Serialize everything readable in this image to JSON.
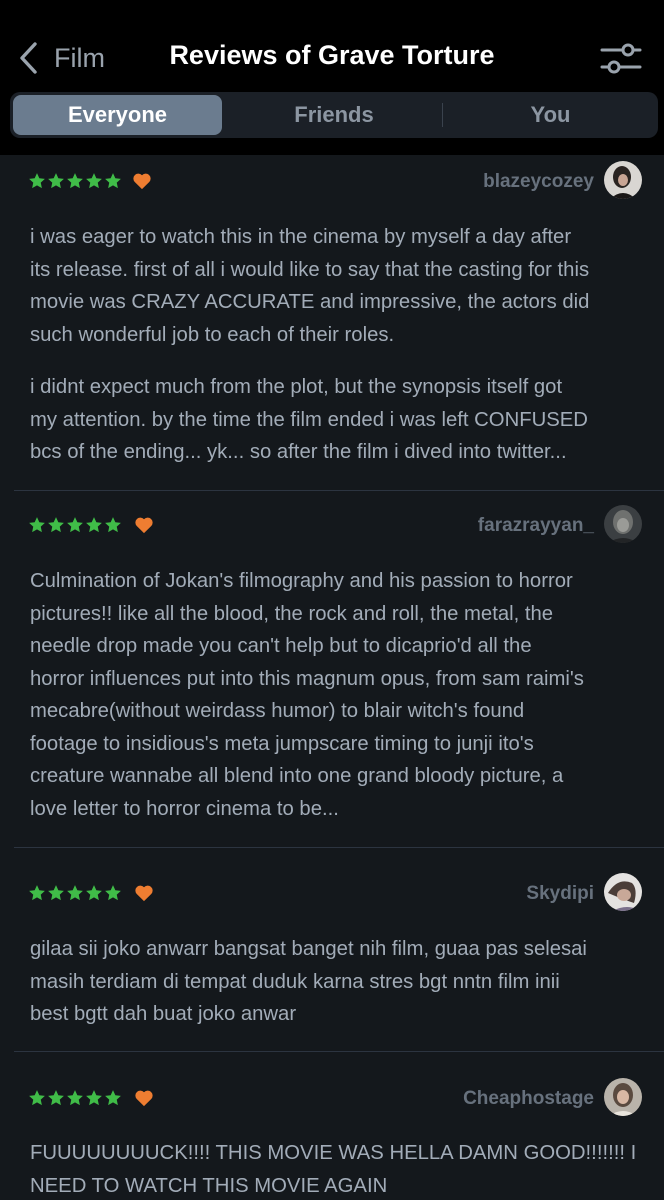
{
  "header": {
    "back_label": "Film",
    "title": "Reviews of Grave Torture"
  },
  "tabs": [
    {
      "label": "Everyone",
      "active": true
    },
    {
      "label": "Friends",
      "active": false
    },
    {
      "label": "You",
      "active": false
    }
  ],
  "colors": {
    "background": "#14181c",
    "star": "#40bc48",
    "heart": "#ee7d31",
    "active_tab": "#6b7c8f"
  },
  "reviews": [
    {
      "username": "blazeycozey",
      "rating": 5,
      "liked": true,
      "lines": [
        [
          "i was eager to watch this in the cinema by myself a day after",
          "its release. first of all i would like to say that the casting for this",
          "movie was CRAZY ACCURATE and impressive, the actors did",
          "such wonderful job to each of their roles."
        ],
        [
          "i didnt expect much from the plot, but the synopsis itself got",
          "my attention. by the time the film ended i was left CONFUSED",
          "bcs of the ending... yk... so after the film i dived into twitter..."
        ]
      ]
    },
    {
      "username": "farazrayyan_",
      "rating": 5,
      "liked": true,
      "lines": [
        [
          "Culmination of Jokan's filmography and his passion to horror",
          "pictures!! like all the blood, the rock and roll, the metal, the",
          "needle drop made you can't help but to dicaprio'd all the",
          "horror influences put into this magnum opus, from sam raimi's",
          "mecabre(without weirdass humor) to blair witch's found",
          "footage to insidious's meta jumpscare timing to junji ito's",
          "creature wannabe all blend into one grand bloody picture, a",
          "love letter to horror cinema to be..."
        ]
      ]
    },
    {
      "username": "Skydipi",
      "rating": 5,
      "liked": true,
      "lines": [
        [
          "gilaa sii joko anwarr bangsat banget nih film, guaa pas selesai",
          "masih terdiam di tempat duduk karna stres bgt nntn film inii",
          "best bgtt dah buat joko anwar"
        ]
      ]
    },
    {
      "username": "Cheaphostage",
      "rating": 5,
      "liked": true,
      "lines": [
        [
          "FUUUUUUUUCK!!!! THIS MOVIE WAS HELLA DAMN GOOD!!!!!!! I",
          "NEED TO WATCH THIS MOVIE AGAIN"
        ]
      ]
    }
  ]
}
